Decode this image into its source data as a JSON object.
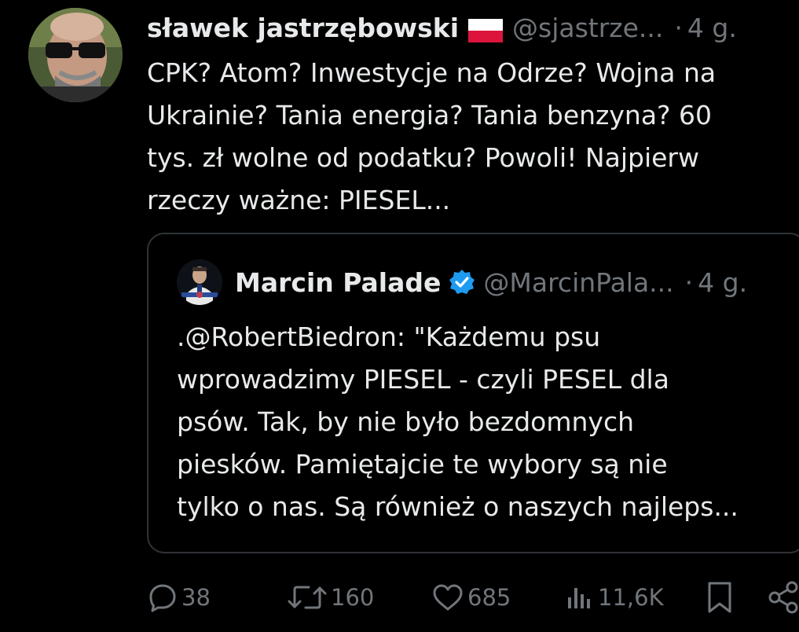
{
  "tweet": {
    "author_name": "sławek jastrzębowski",
    "handle": "@sjastrze...",
    "separator": "·",
    "time": "4 g.",
    "text": "CPK? Atom? Inwestycje na Odrze? Wojna na\nUkrainie? Tania energia? Tania benzyna? 60\ntys. zł wolne od podatku? Powoli! Najpierw\nrzeczy ważne: PIESEL...",
    "flag_icon": "poland-flag-icon"
  },
  "quote": {
    "author_name": "Marcin Palade",
    "handle": "@MarcinPala...",
    "separator": "·",
    "time": "4 g.",
    "verified_icon": "verified-badge-icon",
    "text": ".@RobertBiedron: \"Każdemu psu\nwprowadzimy PIESEL - czyli PESEL dla\npsów. Tak, by nie było bezdomnych\npiesków. Pamiętajcie te wybory są nie\ntylko o nas. Są również o naszych najleps..."
  },
  "actions": {
    "replies": "38",
    "retweets": "160",
    "likes": "685",
    "views": "11,6K"
  },
  "colors": {
    "background": "#000000",
    "text": "#e7e9ea",
    "muted": "#71767b",
    "border": "#2f3336",
    "verified": "#1d9bf0",
    "flag_red": "#dc143c"
  }
}
